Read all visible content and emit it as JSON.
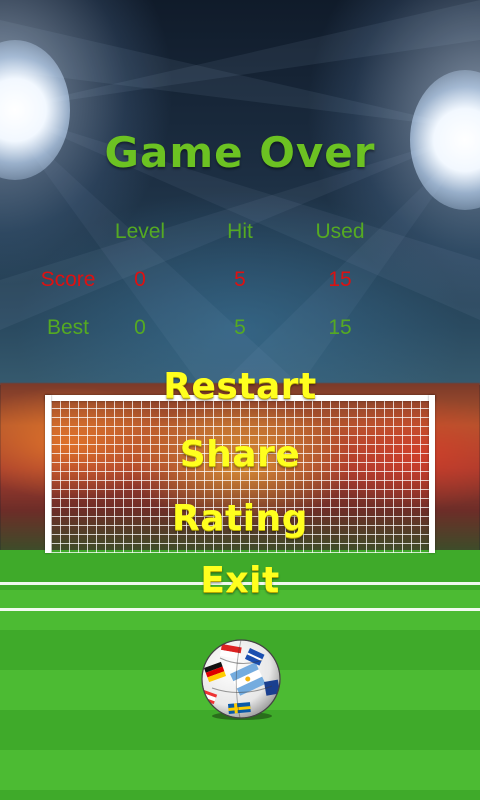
{
  "game_over": {
    "title": "Game Over",
    "columns": [
      "Level",
      "Hit",
      "Used"
    ],
    "score": {
      "label": "Score",
      "level": "0",
      "hit": "5",
      "used": "15"
    },
    "best": {
      "label": "Best",
      "level": "0",
      "hit": "5",
      "used": "15"
    }
  },
  "menu": {
    "restart": "Restart",
    "share": "Share",
    "rating": "Rating",
    "exit": "Exit"
  },
  "colors": {
    "title": "#6cc222",
    "label_green": "#55aa22",
    "score_red": "#dd1111",
    "menu_yellow": "#ffff1e"
  },
  "icons": {
    "ball": "soccer-ball-flags-icon",
    "floodlight": "stadium-floodlight-icon"
  }
}
